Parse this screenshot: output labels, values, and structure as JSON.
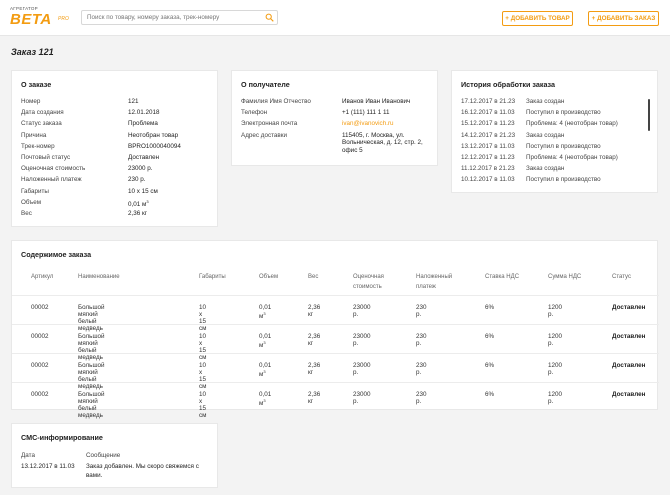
{
  "header": {
    "logo_small": "АГРЕГАТОР",
    "logo_main": "BETA",
    "logo_sub": "PRO",
    "search_placeholder": "Поиск по товару, номеру заказа, трек-номеру",
    "add_product_label": "+ ДОБАВИТЬ ТОВАР",
    "add_order_label": "+ ДОБАВИТЬ ЗАКАЗ"
  },
  "page": {
    "title": "Заказ 121"
  },
  "order": {
    "title": "О заказе",
    "fields": [
      {
        "label": "Номер",
        "value": "121"
      },
      {
        "label": "Дата создания",
        "value": "12.01.2018"
      },
      {
        "label": "Статус заказа",
        "value": "Проблема"
      },
      {
        "label": "Причина",
        "value": "Неотобран товар"
      },
      {
        "label": "Трек-номер",
        "value": "BPRO1000040094"
      },
      {
        "label": "Почтовый статус",
        "value": "Доставлен"
      },
      {
        "label": "Оценочная стоимость",
        "value": "23000 р."
      },
      {
        "label": "Наложенный платеж",
        "value": "230 р."
      },
      {
        "label": "Габариты",
        "value": "10 х 15 см"
      },
      {
        "label": "Объем",
        "value": "0,01 м",
        "sup": "3"
      },
      {
        "label": "Вес",
        "value": "2,36 кг"
      }
    ]
  },
  "recipient": {
    "title": "О получателе",
    "fields": [
      {
        "label": "Фамилия Имя Отчество",
        "value": "Иванов Иван Иванович"
      },
      {
        "label": "Телефон",
        "value": "+1 (111) 111 1 11"
      },
      {
        "label": "Электронная почта",
        "value": "ivan@ivanovich.ru"
      },
      {
        "label": "Адрес доставки",
        "value_lines": [
          "115405, г. Москва, ул.",
          "Вольническая, д. 12, стр. 2,",
          "офис 5"
        ]
      }
    ]
  },
  "history": {
    "title": "История обработки заказа",
    "items": [
      {
        "date": "17.12.2017 в 21.23",
        "event": "Заказ создан"
      },
      {
        "date": "16.12.2017 в 11.03",
        "event": "Поступил в производство"
      },
      {
        "date": "15.12.2017 в 11.23",
        "event": "Проблема: 4 (неотобран товар)"
      },
      {
        "date": "14.12.2017 в 21.23",
        "event": "Заказ создан"
      },
      {
        "date": "13.12.2017 в 11.03",
        "event": "Поступил в производство"
      },
      {
        "date": "12.12.2017 в 11.23",
        "event": "Проблема: 4 (неотобран товар)"
      },
      {
        "date": "11.12.2017 в 21.23",
        "event": "Заказ создан"
      },
      {
        "date": "10.12.2017 в 11.03",
        "event": "Поступил в производство"
      }
    ]
  },
  "contents": {
    "title": "Содержимое заказа",
    "columns": [
      [
        "Артикул"
      ],
      [
        "Наименование"
      ],
      [
        "Габариты"
      ],
      [
        "Объем"
      ],
      [
        "Вес"
      ],
      [
        "Оценочная",
        "стоимость"
      ],
      [
        "Наложенный",
        "платеж"
      ],
      [
        "Ставка НДС"
      ],
      [
        "Сумма НДС"
      ],
      [
        "Статус"
      ]
    ],
    "rows": [
      {
        "sku": "00002",
        "name": "Большой мягкий белый медведь",
        "size": "10 х 15 см",
        "volume": "0,01 м",
        "volume_sup": "3",
        "weight": "2,36 кг",
        "value": "23000 р.",
        "cod": "230 р.",
        "vat_rate": "6%",
        "vat_sum": "1200 р.",
        "status": "Доставлен"
      },
      {
        "sku": "00002",
        "name": "Большой мягкий белый медведь",
        "size": "10 х 15 см",
        "volume": "0,01 м",
        "volume_sup": "3",
        "weight": "2,36 кг",
        "value": "23000 р.",
        "cod": "230 р.",
        "vat_rate": "6%",
        "vat_sum": "1200 р.",
        "status": "Доставлен"
      },
      {
        "sku": "00002",
        "name": "Большой мягкий белый медведь",
        "size": "10 х 15 см",
        "volume": "0,01 м",
        "volume_sup": "3",
        "weight": "2,36 кг",
        "value": "23000 р.",
        "cod": "230 р.",
        "vat_rate": "6%",
        "vat_sum": "1200 р.",
        "status": "Доставлен"
      },
      {
        "sku": "00002",
        "name": "Большой мягкий белый медведь",
        "size": "10 х 15 см",
        "volume": "0,01 м",
        "volume_sup": "3",
        "weight": "2,36 кг",
        "value": "23000 р.",
        "cod": "230 р.",
        "vat_rate": "6%",
        "vat_sum": "1200 р.",
        "status": "Доставлен"
      }
    ]
  },
  "sms": {
    "title": "СМС-информирование",
    "col_date": "Дата",
    "col_message": "Сообщение",
    "date": "13.12.2017 в 11.03",
    "message_lines": [
      "Заказ добавлен. Мы скоро свяжемся с",
      "вами."
    ]
  },
  "colors": {
    "accent": "#f39c12",
    "background": "#f3f3f3"
  },
  "icons": {
    "search": "search-icon"
  }
}
